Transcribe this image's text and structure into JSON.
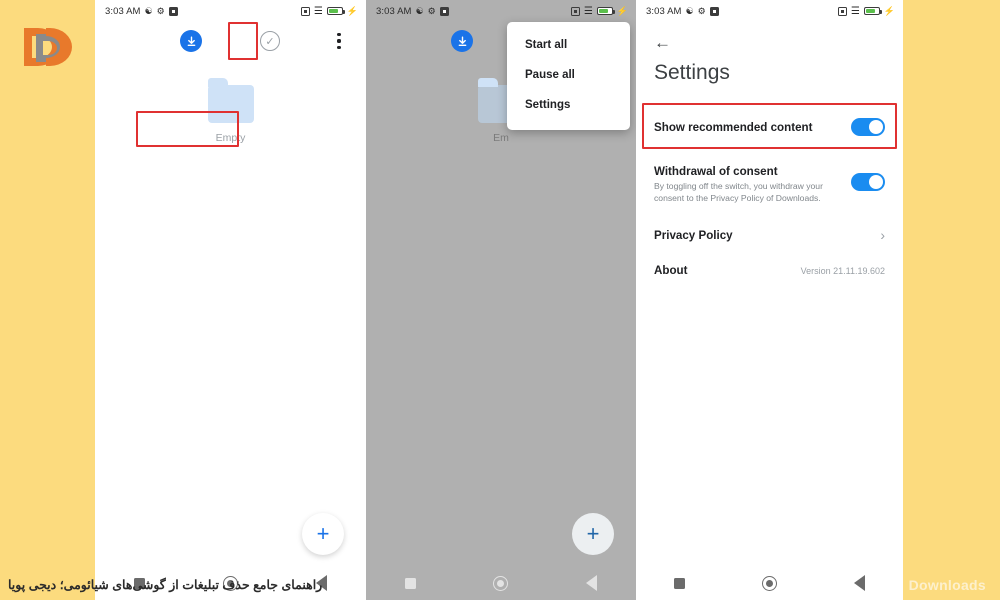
{
  "brand": {
    "logo_name": "DP logo",
    "accent": "#E8792B",
    "secondary": "#8A8A8A"
  },
  "theme": {
    "background": "#FCDB7E",
    "highlight": "#E03131",
    "blue": "#1A73E8",
    "toggle_on": "#1A8CF0"
  },
  "status_bar": {
    "time": "3:03 AM",
    "icons_left": [
      "bluetooth-icon",
      "gear-icon",
      "sim-icon"
    ],
    "icons_right": [
      "no-sim-icon",
      "wifi-icon",
      "battery-icon",
      "charging-icon"
    ]
  },
  "phone1": {
    "toolbar": {
      "download_icon": "download-icon",
      "select_icon": "check-circle-icon",
      "more_icon": "three-dot-menu-icon"
    },
    "empty_state": {
      "icon": "folder-icon",
      "label": "Empty"
    },
    "fab_label": "+",
    "nav": [
      "recents-square-icon",
      "home-circle-icon",
      "back-triangle-icon"
    ]
  },
  "phone2": {
    "menu": {
      "items": [
        {
          "label": "Start all"
        },
        {
          "label": "Pause all"
        },
        {
          "label": "Settings"
        }
      ],
      "highlighted_index": 2
    },
    "empty_state": {
      "label": "Em"
    },
    "fab_label": "+"
  },
  "phone3": {
    "back_icon": "back-arrow-icon",
    "title": "Settings",
    "rows": {
      "recommended": {
        "label": "Show recommended content",
        "toggle": "on"
      },
      "withdrawal": {
        "label": "Withdrawal of consent",
        "sub": "By toggling off the switch, you withdraw your consent to the Privacy Policy of Downloads.",
        "toggle": "on"
      },
      "privacy": {
        "label": "Privacy Policy",
        "chevron": "chevron-right-icon"
      },
      "about": {
        "label": "About",
        "value": "Version 21.11.19.602"
      }
    }
  },
  "footer": {
    "caption_fa": "راهنمای جامع حذف تبلیغات از گوشی‌های شیائومی؛ دیجی پویا",
    "watermark": "Downloads"
  }
}
